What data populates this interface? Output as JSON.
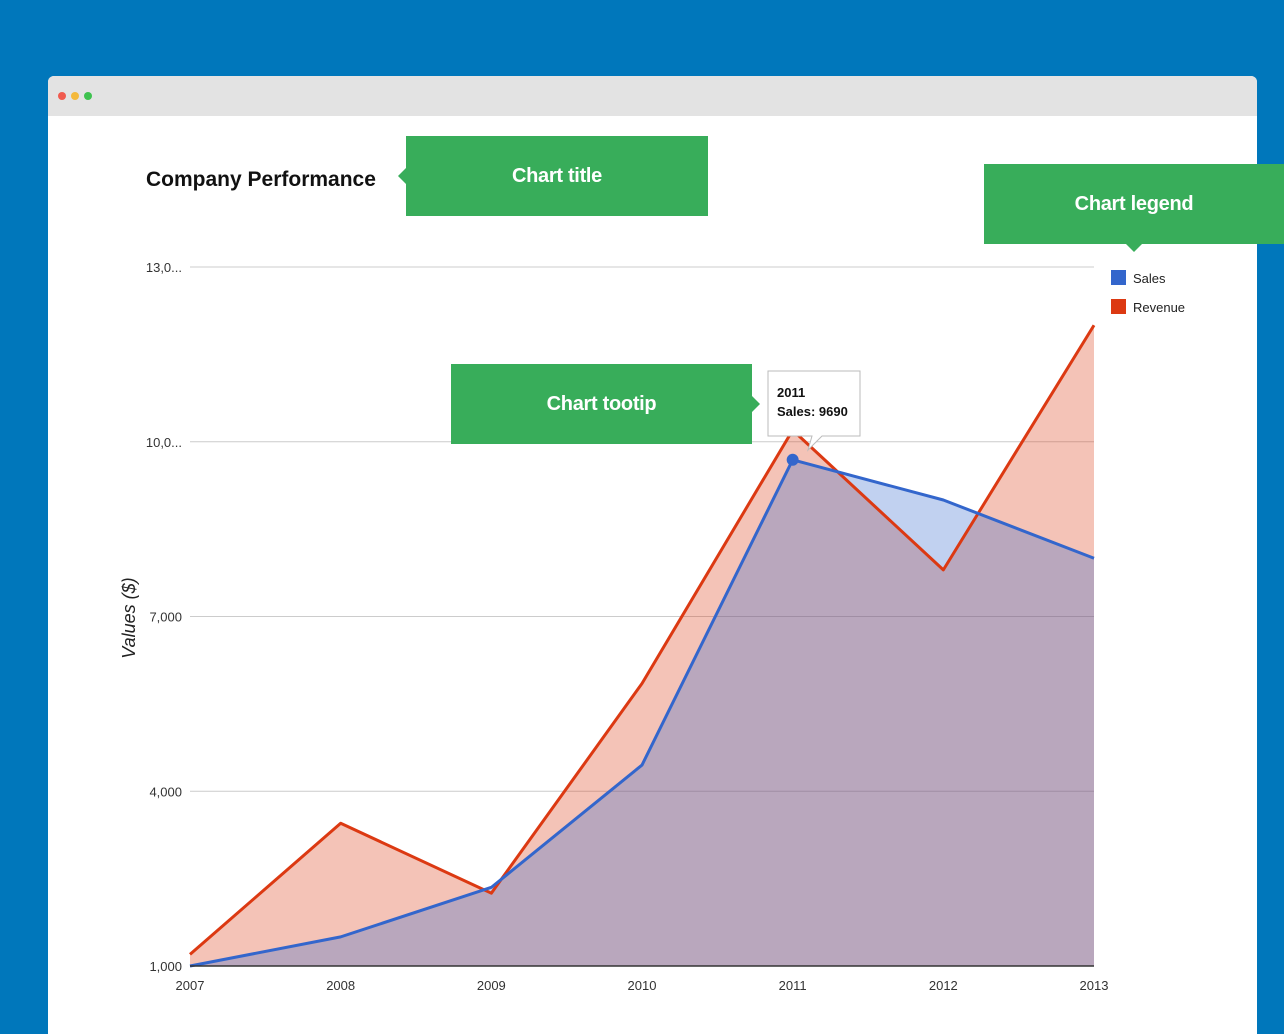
{
  "window": {
    "dots": [
      "close",
      "minimize",
      "maximize"
    ]
  },
  "callouts": {
    "title": "Chart title",
    "tooltip": "Chart tootip",
    "legend": "Chart legend"
  },
  "tooltip": {
    "line1": "2011",
    "line2": "Sales: 9690"
  },
  "colors": {
    "background": "#0077bb",
    "callout": "#38ad5a",
    "sales": "#3366cc",
    "revenue": "#dc3912"
  },
  "chart_data": {
    "type": "area",
    "title": "Company Performance",
    "xlabel": "",
    "ylabel": "Values ($)",
    "categories": [
      "2007",
      "2008",
      "2009",
      "2010",
      "2011",
      "2012",
      "2013"
    ],
    "series": [
      {
        "name": "Sales",
        "values": [
          1000,
          1500,
          2350,
          4450,
          9690,
          9000,
          8000
        ]
      },
      {
        "name": "Revenue",
        "values": [
          1200,
          3450,
          2250,
          5850,
          10200,
          7800,
          12000
        ]
      }
    ],
    "ylim": [
      1000,
      13000
    ],
    "yticks": [
      {
        "value": 1000,
        "label": "1,000"
      },
      {
        "value": 4000,
        "label": "4,000"
      },
      {
        "value": 7000,
        "label": "7,000"
      },
      {
        "value": 10000,
        "label": "10,0..."
      },
      {
        "value": 13000,
        "label": "13,0..."
      }
    ],
    "grid": true,
    "legend_position": "right",
    "highlight": {
      "series": "Sales",
      "category": "2011"
    }
  }
}
